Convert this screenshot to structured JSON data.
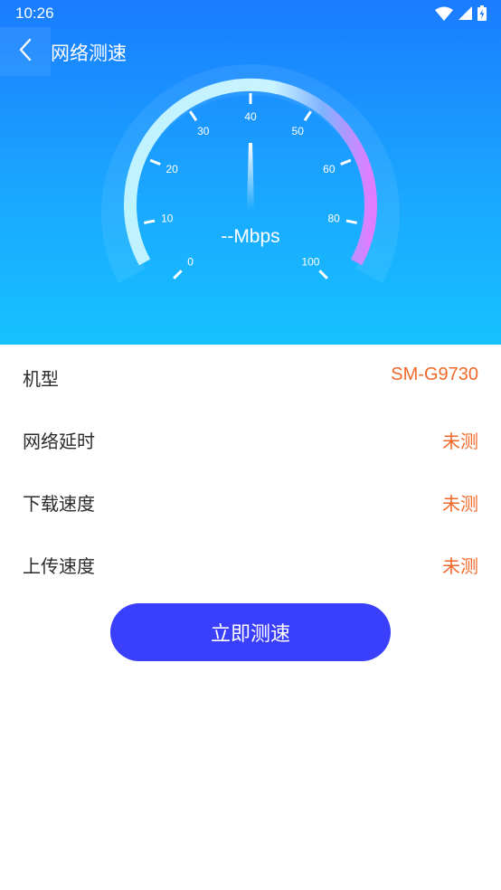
{
  "status_bar": {
    "time": "10:26",
    "icons": [
      "wifi-icon",
      "cellular-signal-icon",
      "battery-charging-icon"
    ]
  },
  "app_bar": {
    "back_icon": "chevron-left-icon",
    "title": "网络测速"
  },
  "gauge": {
    "ticks": [
      "0",
      "10",
      "20",
      "30",
      "40",
      "50",
      "60",
      "80",
      "100"
    ],
    "reading": "--Mbps",
    "needle_value": 40
  },
  "info": {
    "rows": [
      {
        "label": "机型",
        "value": "SM-G9730"
      },
      {
        "label": "网络延时",
        "value": "未测"
      },
      {
        "label": "下载速度",
        "value": "未测"
      },
      {
        "label": "上传速度",
        "value": "未测"
      }
    ]
  },
  "actions": {
    "start_label": "立即测速"
  },
  "colors": {
    "header_top": "#1a7cff",
    "header_bottom": "#15c2ff",
    "value_accent": "#f0692a",
    "button": "#3a3ffb"
  }
}
